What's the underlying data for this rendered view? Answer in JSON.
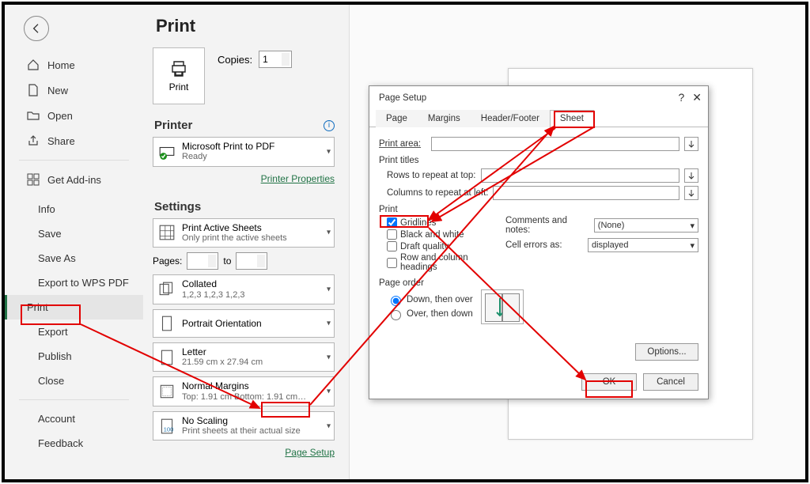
{
  "sidebar": {
    "items": [
      {
        "icon": "home",
        "label": "Home"
      },
      {
        "icon": "new",
        "label": "New"
      },
      {
        "icon": "open",
        "label": "Open"
      },
      {
        "icon": "share",
        "label": "Share"
      }
    ],
    "addins": {
      "icon": "grid",
      "label": "Get Add-ins"
    },
    "file_items": [
      "Info",
      "Save",
      "Save As",
      "Export to WPS PDF",
      "Print",
      "Export",
      "Publish",
      "Close"
    ],
    "bottom_items": [
      "Account",
      "Feedback"
    ]
  },
  "print": {
    "title": "Print",
    "print_btn": "Print",
    "copies_label": "Copies:",
    "copies_value": "1",
    "printer_heading": "Printer",
    "printer_name": "Microsoft Print to PDF",
    "printer_status": "Ready",
    "printer_props_link": "Printer Properties",
    "settings_heading": "Settings",
    "active_sheets": {
      "title": "Print Active Sheets",
      "sub": "Only print the active sheets"
    },
    "pages_label": "Pages:",
    "pages_to": "to",
    "collated": {
      "title": "Collated",
      "sub": "1,2,3   1,2,3   1,2,3"
    },
    "orientation": {
      "title": "Portrait Orientation"
    },
    "paper": {
      "title": "Letter",
      "sub": "21.59 cm x 27.94 cm"
    },
    "margins": {
      "title": "Normal Margins",
      "sub": "Top: 1.91 cm Bottom: 1.91 cm…"
    },
    "scaling": {
      "title": "No Scaling",
      "sub": "Print sheets at their actual size"
    },
    "page_setup_link": "Page Setup"
  },
  "dialog": {
    "title": "Page Setup",
    "tabs": [
      "Page",
      "Margins",
      "Header/Footer",
      "Sheet"
    ],
    "active_tab": 3,
    "print_area_label": "Print area:",
    "print_titles": "Print titles",
    "rows_label": "Rows to repeat at top:",
    "cols_label": "Columns to repeat at left:",
    "print_group": "Print",
    "gridlines": "Gridlines",
    "bw": "Black and white",
    "draft": "Draft quality",
    "rowcol": "Row and column headings",
    "comments_label": "Comments and notes:",
    "comments_value": "(None)",
    "errors_label": "Cell errors as:",
    "errors_value": "displayed",
    "pageorder": "Page order",
    "down_over": "Down, then over",
    "over_down": "Over, then down",
    "options_btn": "Options...",
    "ok_btn": "OK",
    "cancel_btn": "Cancel"
  }
}
